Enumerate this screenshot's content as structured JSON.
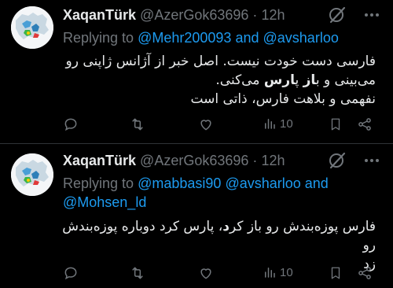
{
  "tweets": [
    {
      "display_name": "XaqanTürk",
      "handle": "@AzerGok63696",
      "separator": "·",
      "time": "12h",
      "replying_prefix": "Replying to",
      "mention_1": "@Mehr200093",
      "conjunction": "and",
      "mention_2": "@avsharloo",
      "mention_3": "",
      "body_lines": [
        "فارسی دست خودت نیست. اصل خبر از آژانس ژاپنی رو",
        "می‌بینی و ب**از** پ**ارس** می‌کنی.",
        "نفهمی و بلاهت فارس، ذاتی است"
      ],
      "views": "10"
    },
    {
      "display_name": "XaqanTürk",
      "handle": "@AzerGok63696",
      "separator": "·",
      "time": "12h",
      "replying_prefix": "Replying to",
      "mention_1": "@mabbasi90",
      "mention_2": "@avsharloo",
      "conjunction": "and",
      "mention_3": "@Mohsen_ld",
      "body_lines": [
        "فارس پوزه‌بندش رو باز کرد، پارس کرد دوباره پوزه‌بندش رو",
        "زد"
      ],
      "views": "10"
    }
  ],
  "colors": {
    "background": "#000000",
    "text": "#e7e9ea",
    "muted": "#71767b",
    "link": "#1d9bf0",
    "divider": "#2f3336"
  },
  "icons": [
    "grok-icon",
    "more-icon",
    "reply-icon",
    "retweet-icon",
    "like-icon",
    "views-icon",
    "bookmark-icon",
    "share-icon"
  ]
}
